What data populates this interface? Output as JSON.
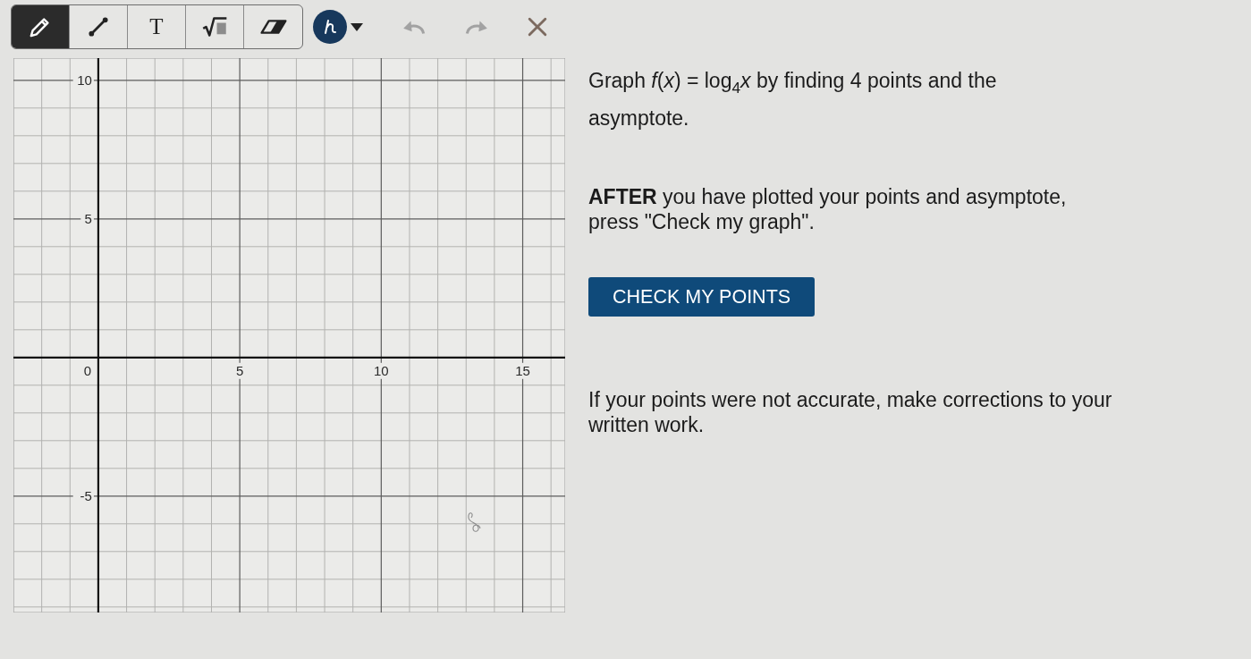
{
  "toolbar": {
    "tools": [
      {
        "kind": "pencil",
        "selected": true
      },
      {
        "kind": "line",
        "selected": false
      },
      {
        "kind": "text",
        "label": "T",
        "selected": false
      },
      {
        "kind": "equation",
        "selected": false
      },
      {
        "kind": "eraser",
        "selected": false
      }
    ],
    "actions": [
      {
        "kind": "undo",
        "disabled": true
      },
      {
        "kind": "redo",
        "disabled": true
      },
      {
        "kind": "clear",
        "disabled": false
      }
    ]
  },
  "graph": {
    "origin_label": "0",
    "x_labels": [
      "5",
      "10",
      "15"
    ],
    "y_labels": [
      "10",
      "5",
      "-5"
    ]
  },
  "instructions": {
    "task": "Graph *f*(*x*) = log$_{4}$*x* by finding 4 points and the asymptote.",
    "after": "**AFTER** you have plotted your points and asymptote, press \"Check my graph\".",
    "button": "CHECK MY POINTS",
    "note": "If your points were not accurate, make corrections to your written work."
  }
}
